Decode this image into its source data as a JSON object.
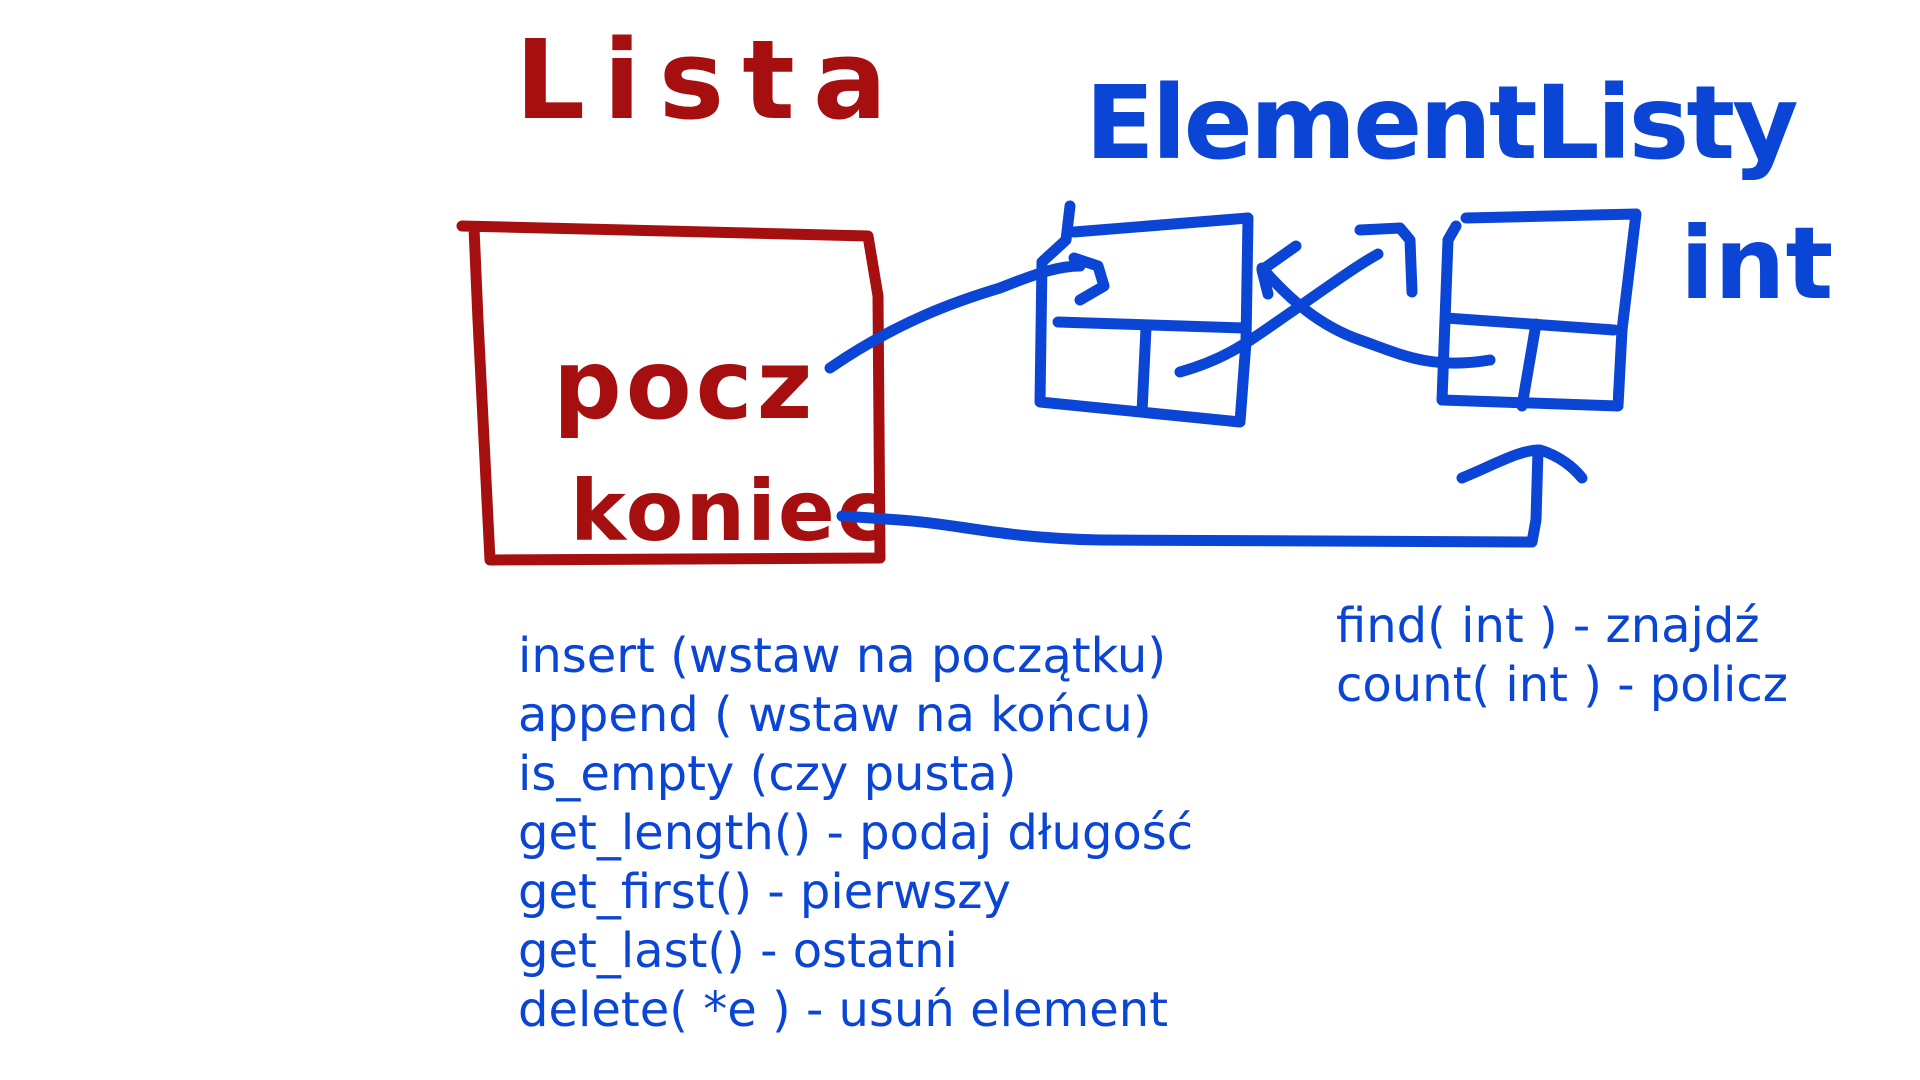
{
  "colors": {
    "red": "#a50f0f",
    "blue": "#0a45d6",
    "background": "#ffffff"
  },
  "list_struct": {
    "title": "Lista",
    "fields": [
      "pocz",
      "koniec"
    ]
  },
  "element_struct": {
    "title": "ElementListy",
    "value_type": "int"
  },
  "operations_left": [
    "insert (wstaw na początku)",
    "append ( wstaw na końcu)",
    "is_empty (czy pusta)",
    "get_length() - podaj długość",
    "get_first() - pierwszy",
    "get_last() - ostatni",
    "delete( *e ) - usuń element"
  ],
  "operations_right": [
    "find( int ) - znajdź",
    "count( int ) - policz"
  ]
}
